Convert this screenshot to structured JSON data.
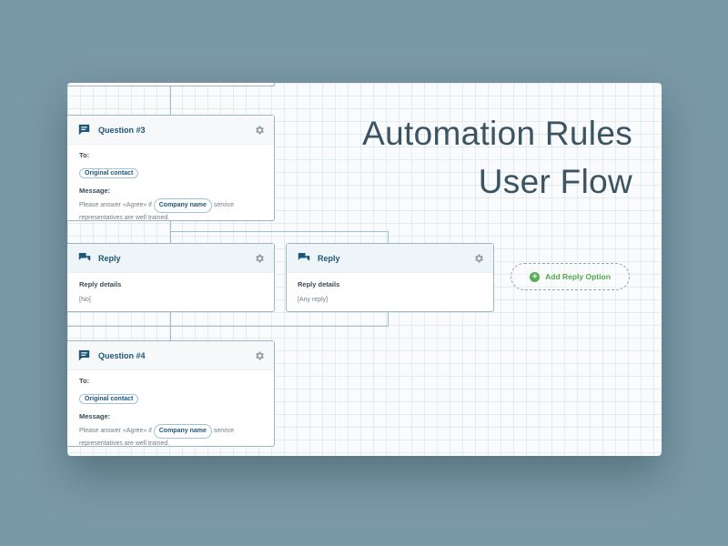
{
  "title": {
    "line1": "Automation Rules",
    "line2": "User Flow"
  },
  "question3": {
    "title": "Question #3",
    "to_label": "To:",
    "to_value": "Original contact",
    "message_label": "Message:",
    "msg_before": "Please answer «Agree» if",
    "msg_token": "Company name",
    "msg_after": "service",
    "msg_line2": "representatives are well trained."
  },
  "reply_no": {
    "title": "Reply",
    "details_label": "Reply details",
    "details_value": "[No]"
  },
  "reply_any": {
    "title": "Reply",
    "details_label": "Reply details",
    "details_value": "[Any reply]"
  },
  "add_reply": {
    "label": "Add Reply Option"
  },
  "question4": {
    "title": "Question #4",
    "to_label": "To:",
    "to_value": "Original contact",
    "message_label": "Message:",
    "msg_before": "Please answer «Agree» if",
    "msg_token": "Company name",
    "msg_after": "service",
    "msg_line2": "representatives are well trained."
  },
  "colors": {
    "background": "#7a99a6",
    "accent": "#1f5677",
    "add_green": "#4fa84a",
    "title": "#3c5462"
  },
  "icons": {
    "question": "chat-bubble-icon",
    "reply": "chat-bubbles-icon",
    "settings": "gear-icon",
    "add": "plus-circle-icon"
  }
}
